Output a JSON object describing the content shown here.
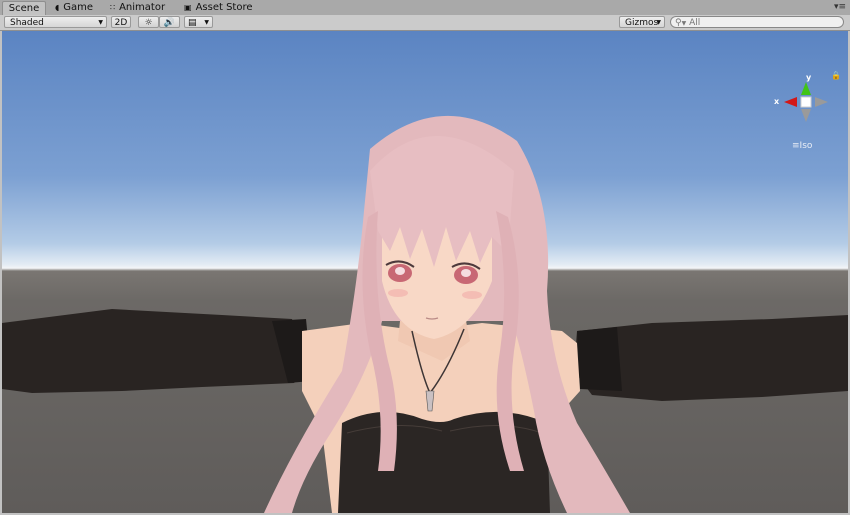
{
  "tabs": [
    {
      "label": "Scene",
      "icon": "grid-icon",
      "active": true
    },
    {
      "label": "Game",
      "icon": "pacman-icon",
      "active": false
    },
    {
      "label": "Animator",
      "icon": "animator-icon",
      "active": false
    },
    {
      "label": "Asset Store",
      "icon": "bag-icon",
      "active": false
    }
  ],
  "toolbar": {
    "draw_mode": "Shaded",
    "mode_2d": "2D",
    "gizmos_label": "Gizmos",
    "search_placeholder": "All"
  },
  "gizmo": {
    "y_label": "y",
    "x_label": "x",
    "projection_label": "Iso"
  },
  "colors": {
    "sky_top": "#5b84c2",
    "horizon": "#f4f6f8",
    "ground": "#6c6966",
    "hair": "#e0b7ba",
    "skin": "#f6d3be",
    "clothes": "#2a2523",
    "axis_x": "#d21818",
    "axis_y": "#41c416"
  }
}
